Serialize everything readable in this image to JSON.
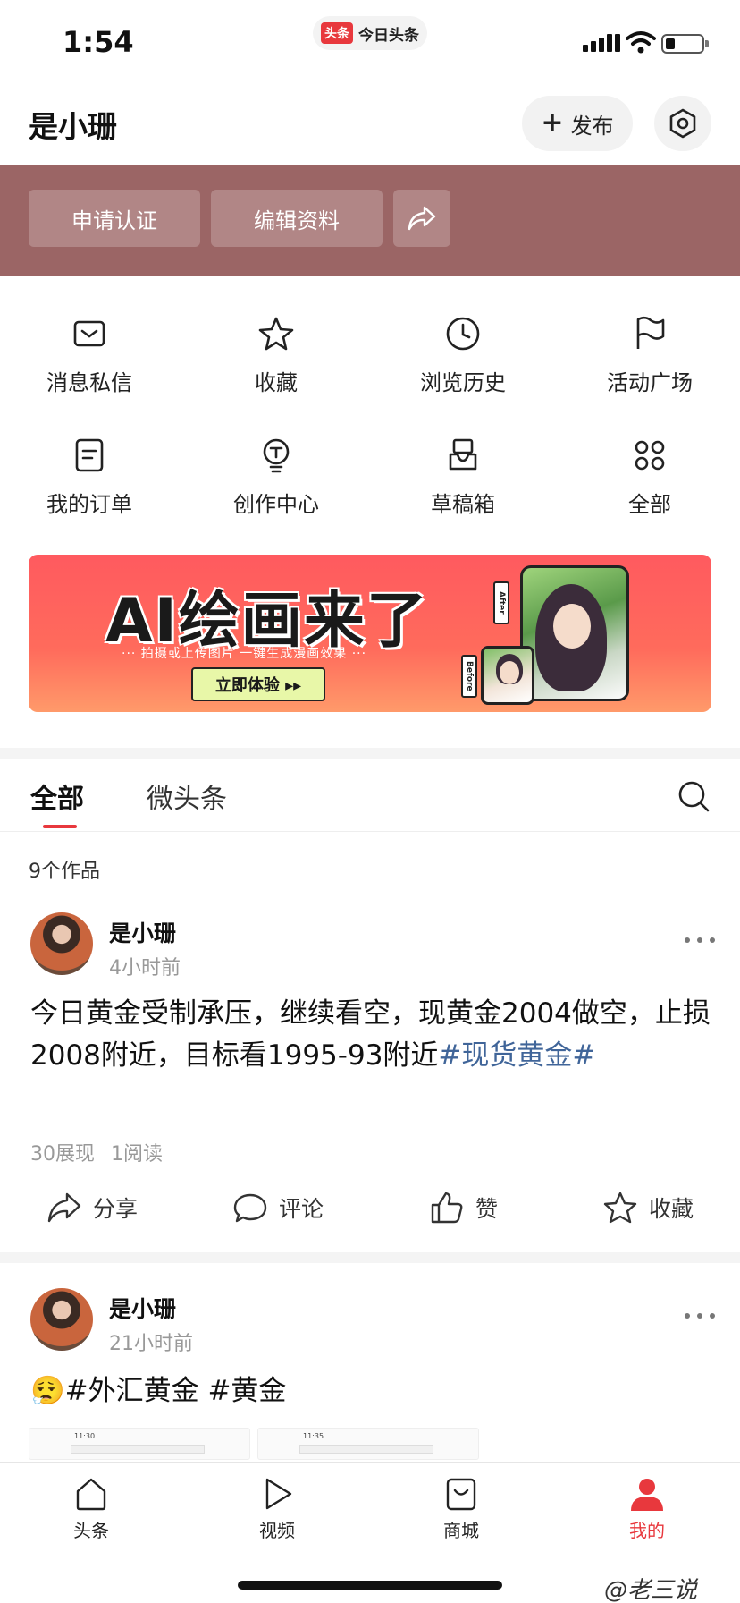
{
  "status_bar": {
    "time": "1:54",
    "app_badge": "头条",
    "app_name": "今日头条"
  },
  "header": {
    "username": "是小珊",
    "publish_label": "发布",
    "settings_icon": "gear-icon"
  },
  "profile_actions": {
    "apply_verify": "申请认证",
    "edit_profile": "编辑资料",
    "share_icon": "share-icon"
  },
  "grid": [
    {
      "label": "消息私信",
      "icon": "message-icon"
    },
    {
      "label": "收藏",
      "icon": "star-icon"
    },
    {
      "label": "浏览历史",
      "icon": "clock-icon"
    },
    {
      "label": "活动广场",
      "icon": "flag-icon"
    },
    {
      "label": "我的订单",
      "icon": "order-icon"
    },
    {
      "label": "创作中心",
      "icon": "bulb-icon"
    },
    {
      "label": "草稿箱",
      "icon": "draft-box-icon"
    },
    {
      "label": "全部",
      "icon": "grid-icon"
    }
  ],
  "banner": {
    "title": "AI绘画来了",
    "subtitle": "··· 拍摄或上传图片  一键生成漫画效果 ···",
    "cta": "立即体验 ▸▸",
    "after_tag": "After",
    "before_tag": "Before"
  },
  "tabs": {
    "all": "全部",
    "micro": "微头条"
  },
  "works_count": "9个作品",
  "posts": [
    {
      "author": "是小珊",
      "time": "4小时前",
      "text": "今日黄金受制承压，继续看空，现黄金2004做空，止损2008附近，目标看1995-93附近",
      "hashtag": "#现货黄金#",
      "views": "30展现",
      "reads": "1阅读",
      "share": "分享",
      "comment": "评论",
      "like": "赞",
      "favorite": "收藏"
    },
    {
      "author": "是小珊",
      "time": "21小时前",
      "emoji": "😮‍💨",
      "text": "#外汇黄金 #黄金",
      "thumb1_time": "11:30",
      "thumb2_time": "11:35"
    }
  ],
  "bottom_nav": [
    {
      "label": "头条",
      "icon": "home-icon"
    },
    {
      "label": "视频",
      "icon": "play-icon"
    },
    {
      "label": "商城",
      "icon": "shopping-bag-icon"
    },
    {
      "label": "我的",
      "icon": "person-icon"
    }
  ],
  "watermark": "@老三说",
  "colors": {
    "accent": "#e8383d",
    "band": "#9b6565",
    "link": "#406599"
  }
}
